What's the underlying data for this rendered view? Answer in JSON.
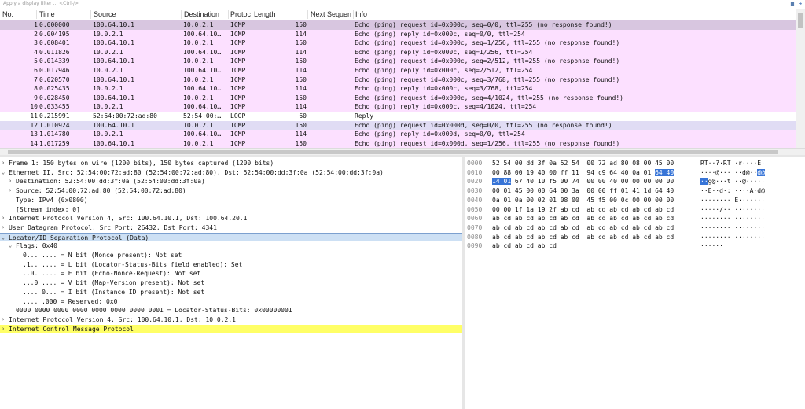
{
  "filter": {
    "placeholder": "Apply a display filter ... <Ctrl-/>"
  },
  "columns": {
    "no": "No.",
    "time": "Time",
    "source": "Source",
    "destination": "Destination",
    "protocol": "Protoc",
    "length": "Length",
    "next_seq": "Next Sequen",
    "info": "Info"
  },
  "colors": {
    "icmp_row": "#fce0ff",
    "loop_row": "#ffffff",
    "selected_row": "#d8c6e0",
    "selected_loop": "#e0dcf4"
  },
  "packets": [
    {
      "no": "1",
      "time": "0.000000",
      "src": "100.64.10.1",
      "dst": "10.0.2.1",
      "proto": "ICMP",
      "len": "150",
      "info": "Echo (ping) request  id=0x000c, seq=0/0, ttl=255 (no response found!)",
      "kind": "selected"
    },
    {
      "no": "2",
      "time": "0.004195",
      "src": "10.0.2.1",
      "dst": "100.64.10…",
      "proto": "ICMP",
      "len": "114",
      "info": "Echo (ping) reply    id=0x000c, seq=0/0, ttl=254",
      "kind": "icmp"
    },
    {
      "no": "3",
      "time": "0.008401",
      "src": "100.64.10.1",
      "dst": "10.0.2.1",
      "proto": "ICMP",
      "len": "150",
      "info": "Echo (ping) request  id=0x000c, seq=1/256, ttl=255 (no response found!)",
      "kind": "icmp"
    },
    {
      "no": "4",
      "time": "0.011826",
      "src": "10.0.2.1",
      "dst": "100.64.10…",
      "proto": "ICMP",
      "len": "114",
      "info": "Echo (ping) reply    id=0x000c, seq=1/256, ttl=254",
      "kind": "icmp"
    },
    {
      "no": "5",
      "time": "0.014339",
      "src": "100.64.10.1",
      "dst": "10.0.2.1",
      "proto": "ICMP",
      "len": "150",
      "info": "Echo (ping) request  id=0x000c, seq=2/512, ttl=255 (no response found!)",
      "kind": "icmp"
    },
    {
      "no": "6",
      "time": "0.017946",
      "src": "10.0.2.1",
      "dst": "100.64.10…",
      "proto": "ICMP",
      "len": "114",
      "info": "Echo (ping) reply    id=0x000c, seq=2/512, ttl=254",
      "kind": "icmp"
    },
    {
      "no": "7",
      "time": "0.020570",
      "src": "100.64.10.1",
      "dst": "10.0.2.1",
      "proto": "ICMP",
      "len": "150",
      "info": "Echo (ping) request  id=0x000c, seq=3/768, ttl=255 (no response found!)",
      "kind": "icmp"
    },
    {
      "no": "8",
      "time": "0.025435",
      "src": "10.0.2.1",
      "dst": "100.64.10…",
      "proto": "ICMP",
      "len": "114",
      "info": "Echo (ping) reply    id=0x000c, seq=3/768, ttl=254",
      "kind": "icmp"
    },
    {
      "no": "9",
      "time": "0.028450",
      "src": "100.64.10.1",
      "dst": "10.0.2.1",
      "proto": "ICMP",
      "len": "150",
      "info": "Echo (ping) request  id=0x000c, seq=4/1024, ttl=255 (no response found!)",
      "kind": "icmp"
    },
    {
      "no": "10",
      "time": "0.033455",
      "src": "10.0.2.1",
      "dst": "100.64.10…",
      "proto": "ICMP",
      "len": "114",
      "info": "Echo (ping) reply    id=0x000c, seq=4/1024, ttl=254",
      "kind": "icmp"
    },
    {
      "no": "11",
      "time": "0.215991",
      "src": "52:54:00:72:ad:80",
      "dst": "52:54:00:…",
      "proto": "LOOP",
      "len": "60",
      "info": "Reply",
      "kind": "loop"
    },
    {
      "no": "12",
      "time": "1.010924",
      "src": "100.64.10.1",
      "dst": "10.0.2.1",
      "proto": "ICMP",
      "len": "150",
      "info": "Echo (ping) request  id=0x000d, seq=0/0, ttl=255 (no response found!)",
      "kind": "selected2"
    },
    {
      "no": "13",
      "time": "1.014780",
      "src": "10.0.2.1",
      "dst": "100.64.10…",
      "proto": "ICMP",
      "len": "114",
      "info": "Echo (ping) reply    id=0x000d, seq=0/0, ttl=254",
      "kind": "icmp"
    },
    {
      "no": "14",
      "time": "1.017259",
      "src": "100.64.10.1",
      "dst": "10.0.2.1",
      "proto": "ICMP",
      "len": "150",
      "info": "Echo (ping) request  id=0x000d, seq=1/256, ttl=255 (no response found!)",
      "kind": "icmp"
    }
  ],
  "details": [
    {
      "indent": 0,
      "tw": ">",
      "text": "Frame 1: 150 bytes on wire (1200 bits), 150 bytes captured (1200 bits)",
      "style": ""
    },
    {
      "indent": 0,
      "tw": "v",
      "text": "Ethernet II, Src: 52:54:00:72:ad:80 (52:54:00:72:ad:80), Dst: 52:54:00:dd:3f:0a (52:54:00:dd:3f:0a)",
      "style": ""
    },
    {
      "indent": 1,
      "tw": ">",
      "text": "Destination: 52:54:00:dd:3f:0a (52:54:00:dd:3f:0a)",
      "style": ""
    },
    {
      "indent": 1,
      "tw": ">",
      "text": "Source: 52:54:00:72:ad:80 (52:54:00:72:ad:80)",
      "style": ""
    },
    {
      "indent": 1,
      "tw": "",
      "text": "Type: IPv4 (0x0800)",
      "style": ""
    },
    {
      "indent": 1,
      "tw": "",
      "text": "[Stream index: 0]",
      "style": ""
    },
    {
      "indent": 0,
      "tw": ">",
      "text": "Internet Protocol Version 4, Src: 100.64.10.1, Dst: 100.64.20.1",
      "style": ""
    },
    {
      "indent": 0,
      "tw": ">",
      "text": "User Datagram Protocol, Src Port: 26432, Dst Port: 4341",
      "style": ""
    },
    {
      "indent": 0,
      "tw": "v",
      "text": "Locator/ID Separation Protocol (Data)",
      "style": "sel"
    },
    {
      "indent": 1,
      "tw": "v",
      "text": "Flags: 0x40",
      "style": ""
    },
    {
      "indent": 2,
      "tw": "",
      "text": "0... .... = N bit (Nonce present): Not set",
      "style": ""
    },
    {
      "indent": 2,
      "tw": "",
      "text": ".1.. .... = L bit (Locator-Status-Bits field enabled): Set",
      "style": ""
    },
    {
      "indent": 2,
      "tw": "",
      "text": "..0. .... = E bit (Echo-Nonce-Request): Not set",
      "style": ""
    },
    {
      "indent": 2,
      "tw": "",
      "text": "...0 .... = V bit (Map-Version present): Not set",
      "style": ""
    },
    {
      "indent": 2,
      "tw": "",
      "text": ".... 0... = I bit (Instance ID present): Not set",
      "style": ""
    },
    {
      "indent": 2,
      "tw": "",
      "text": ".... .000 = Reserved: 0x0",
      "style": ""
    },
    {
      "indent": 1,
      "tw": "",
      "text": "0000 0000 0000 0000 0000 0000 0000 0001 = Locator-Status-Bits: 0x00000001",
      "style": ""
    },
    {
      "indent": 0,
      "tw": ">",
      "text": "Internet Protocol Version 4, Src: 100.64.10.1, Dst: 10.0.2.1",
      "style": ""
    },
    {
      "indent": 0,
      "tw": ">",
      "text": "Internet Control Message Protocol",
      "style": "hl"
    }
  ],
  "bytes": [
    {
      "off": "0000",
      "pre": "52 54 00 dd 3f 0a 52 54  00 72 ad 80 08 00 45 00",
      "sel": "",
      "post": "",
      "apre": "RT··?·RT ·r····E·",
      "asel": "",
      "apost": ""
    },
    {
      "off": "0010",
      "pre": "00 88 00 19 40 00 ff 11  94 c9 64 40 0a 01 ",
      "sel": "64 40",
      "post": "",
      "apre": "····@··· ··d@··",
      "asel": "d@",
      "apost": ""
    },
    {
      "off": "0020",
      "pre": "",
      "sel": "14 01",
      "post": " 67 40 10 f5 00 74  00 00 40 00 00 00 00 00",
      "apre": "",
      "asel": "··",
      "apost": "g@···t ··@·····"
    },
    {
      "off": "0030",
      "pre": "00 01 45 00 00 64 00 3a  00 00 ff 01 41 1d 64 40",
      "sel": "",
      "post": "",
      "apre": "··E··d·: ····A·d@",
      "asel": "",
      "apost": ""
    },
    {
      "off": "0040",
      "pre": "0a 01 0a 00 02 01 08 00  45 f5 00 0c 00 00 00 00",
      "sel": "",
      "post": "",
      "apre": "········ E·······",
      "asel": "",
      "apost": ""
    },
    {
      "off": "0050",
      "pre": "00 00 1f 1a 19 2f ab cd  ab cd ab cd ab cd ab cd",
      "sel": "",
      "post": "",
      "apre": "·····/·· ········",
      "asel": "",
      "apost": ""
    },
    {
      "off": "0060",
      "pre": "ab cd ab cd ab cd ab cd  ab cd ab cd ab cd ab cd",
      "sel": "",
      "post": "",
      "apre": "········ ········",
      "asel": "",
      "apost": ""
    },
    {
      "off": "0070",
      "pre": "ab cd ab cd ab cd ab cd  ab cd ab cd ab cd ab cd",
      "sel": "",
      "post": "",
      "apre": "········ ········",
      "asel": "",
      "apost": ""
    },
    {
      "off": "0080",
      "pre": "ab cd ab cd ab cd ab cd  ab cd ab cd ab cd ab cd",
      "sel": "",
      "post": "",
      "apre": "········ ········",
      "asel": "",
      "apost": ""
    },
    {
      "off": "0090",
      "pre": "ab cd ab cd ab cd",
      "sel": "",
      "post": "",
      "apre": "······",
      "asel": "",
      "apost": ""
    }
  ]
}
